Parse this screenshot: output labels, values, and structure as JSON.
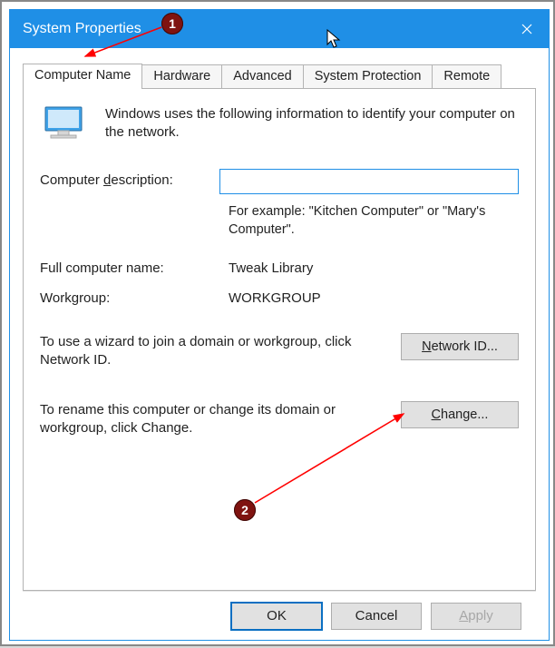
{
  "window": {
    "title": "System Properties",
    "close_icon_name": "close-icon"
  },
  "tabs": [
    {
      "label": "Computer Name",
      "active": true
    },
    {
      "label": "Hardware",
      "active": false
    },
    {
      "label": "Advanced",
      "active": false
    },
    {
      "label": "System Protection",
      "active": false
    },
    {
      "label": "Remote",
      "active": false
    }
  ],
  "intro": "Windows uses the following information to identify your computer on the network.",
  "fields": {
    "description_label_pre": "Computer ",
    "description_label_u": "d",
    "description_label_post": "escription:",
    "description_value": "",
    "description_hint": "For example: \"Kitchen Computer\" or \"Mary's Computer\".",
    "fullname_label": "Full computer name:",
    "fullname_value": "Tweak Library",
    "workgroup_label": "Workgroup:",
    "workgroup_value": "WORKGROUP"
  },
  "sections": {
    "networkid_text": "To use a wizard to join a domain or workgroup, click Network ID.",
    "networkid_btn_u": "N",
    "networkid_btn_post": "etwork ID...",
    "change_text": "To rename this computer or change its domain or workgroup, click Change.",
    "change_btn_u": "C",
    "change_btn_post": "hange..."
  },
  "buttons": {
    "ok": "OK",
    "cancel": "Cancel",
    "apply_u": "A",
    "apply_post": "pply"
  },
  "annotations": {
    "badge1": "1",
    "badge2": "2"
  }
}
